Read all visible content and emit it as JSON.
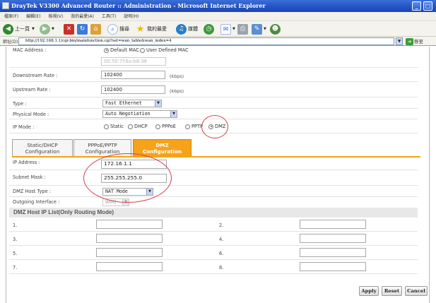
{
  "window": {
    "title": "DrayTek V3300 Advanced Router :: Administration - Microsoft Internet Explorer"
  },
  "menubar": {
    "items": [
      "檔案(F)",
      "編輯(E)",
      "檢視(V)",
      "我的最愛(A)",
      "工具(T)",
      "說明(H)"
    ]
  },
  "toolbar": {
    "back_label": "上一頁",
    "search_label": "搜尋",
    "favorites_label": "我的最愛",
    "media_label": "媒體"
  },
  "addressbar": {
    "label": "網址(D)",
    "url": "http://192.168.1.1/cgi-bin/mainfunction.cgi?set=wan_table&wan_index=4",
    "go_label": "移至"
  },
  "wan_settings": {
    "mac_label": "MAC Address :",
    "mac_options": [
      "Default MAC",
      "User Defined MAC"
    ],
    "mac_value": "00:50:7f:6a:b8:38",
    "downstream_label": "Downstream Rate :",
    "downstream_value": "102400",
    "upstream_label": "Upstream Rate :",
    "upstream_value": "102400",
    "rate_unit": "(kbps)",
    "type_label": "Type :",
    "type_value": "Fast Ethernet",
    "physical_mode_label": "Physical Mode :",
    "physical_mode_value": "Auto Negotiation",
    "ip_mode_label": "IP Mode :",
    "ip_modes": [
      "Static",
      "DHCP",
      "PPPoE",
      "PPTP",
      "DMZ"
    ],
    "ip_mode_selected": "DMZ"
  },
  "tabs": [
    {
      "line1": "Static/DHCP",
      "line2": "Configuration"
    },
    {
      "line1": "PPPoE/PPTP",
      "line2": "Configuration"
    },
    {
      "line1": "DMZ",
      "line2": "Configuration"
    }
  ],
  "dmz": {
    "ip_label": "IP Address :",
    "ip_value": "172.16.1.1",
    "mask_label": "Subnet Mask :",
    "mask_value": "255.255.255.0",
    "host_type_label": "DMZ Host Type :",
    "host_type_value": "NAT Mode",
    "outgoing_label": "Outgoing Interface :",
    "outgoing_value": "WAN1"
  },
  "host_list": {
    "title": "DMZ Host IP List(Only Routing Mode)",
    "numbers": [
      "1.",
      "2.",
      "3.",
      "4.",
      "5.",
      "6.",
      "7.",
      "8."
    ]
  },
  "buttons": {
    "apply": "Apply",
    "reset": "Reset",
    "cancel": "Cancel"
  },
  "colors": {
    "active_tab": "#f4a31a",
    "annotation_circle": "#d6424b",
    "titlebar": "#2352c4"
  }
}
